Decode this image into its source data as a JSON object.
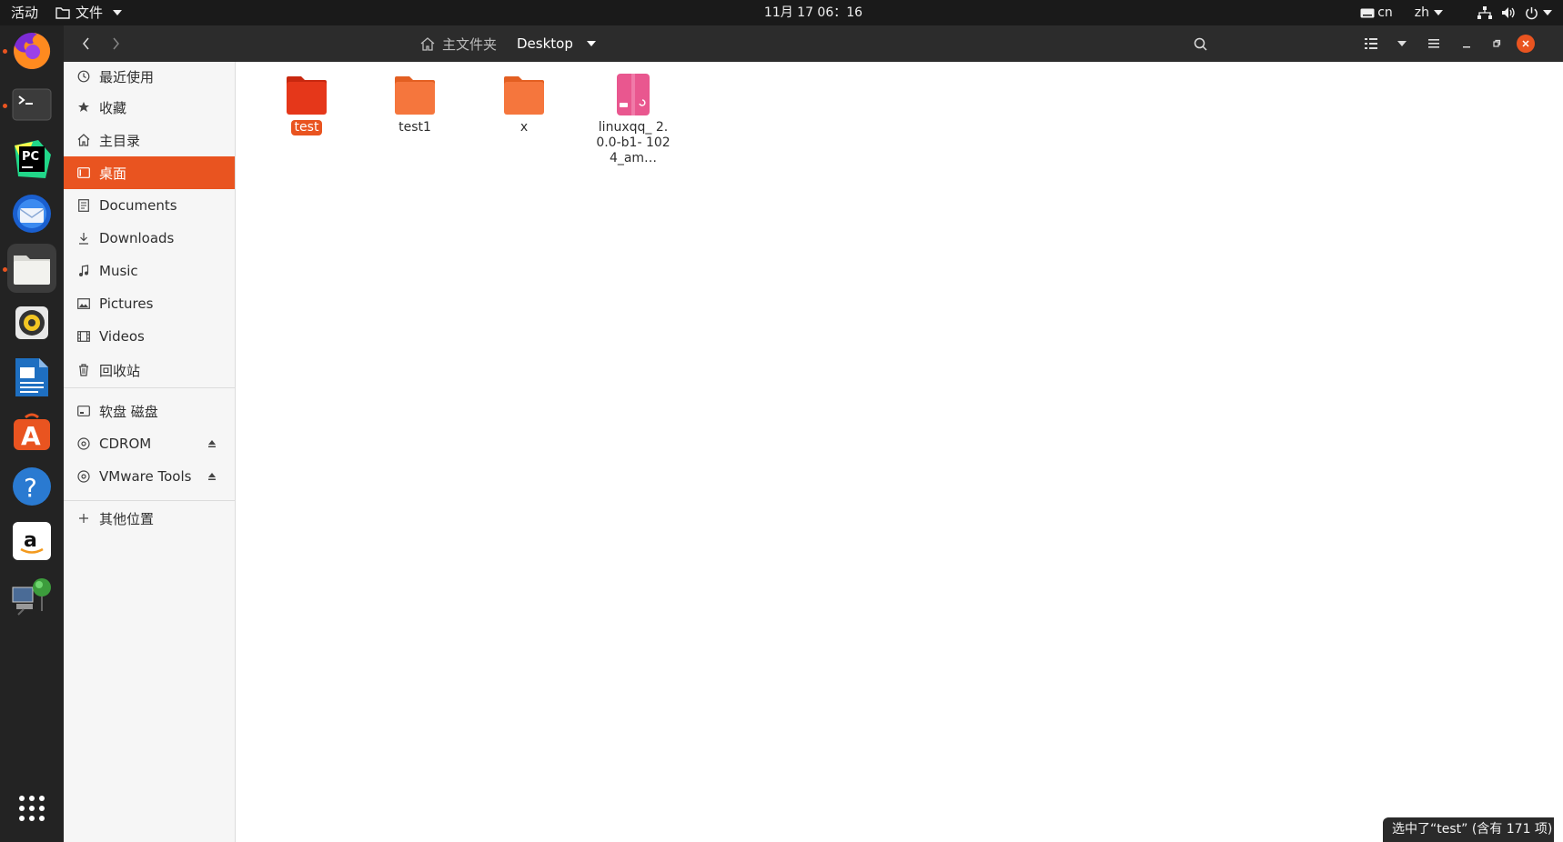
{
  "topbar": {
    "activities": "活动",
    "app_menu": "文件",
    "clock": "11月 17  06：16",
    "keyboard": "cn",
    "input_method": "zh"
  },
  "dock": {
    "items": [
      {
        "name": "firefox",
        "running": true
      },
      {
        "name": "terminal",
        "running": true
      },
      {
        "name": "pycharm",
        "running": false
      },
      {
        "name": "thunderbird",
        "running": false
      },
      {
        "name": "files",
        "running": true,
        "active": true
      },
      {
        "name": "rhythmbox",
        "running": false
      },
      {
        "name": "libreoffice-writer",
        "running": false
      },
      {
        "name": "ubuntu-software",
        "running": false
      },
      {
        "name": "help",
        "running": false
      },
      {
        "name": "amazon",
        "running": false
      },
      {
        "name": "remote-desktop",
        "running": false
      },
      {
        "name": "show-applications",
        "running": false
      }
    ]
  },
  "headerbar": {
    "home_label": "主文件夹",
    "current_label": "Desktop"
  },
  "sidebar": {
    "items": [
      {
        "label": "最近使用",
        "icon": "clock-icon"
      },
      {
        "label": "收藏",
        "icon": "star-icon"
      },
      {
        "label": "主目录",
        "icon": "home-icon"
      },
      {
        "label": "桌面",
        "icon": "desktop-icon",
        "selected": true
      },
      {
        "label": "Documents",
        "icon": "document-icon"
      },
      {
        "label": "Downloads",
        "icon": "download-icon"
      },
      {
        "label": "Music",
        "icon": "music-icon"
      },
      {
        "label": "Pictures",
        "icon": "picture-icon"
      },
      {
        "label": "Videos",
        "icon": "video-icon"
      },
      {
        "label": "回收站",
        "icon": "trash-icon"
      }
    ],
    "devices": [
      {
        "label": "软盘 磁盘",
        "icon": "drive-icon"
      },
      {
        "label": "CDROM",
        "icon": "disc-icon",
        "eject": true
      },
      {
        "label": "VMware Tools",
        "icon": "disc-icon",
        "eject": true
      }
    ],
    "other": {
      "label": "其他位置",
      "icon": "plus-icon"
    }
  },
  "files": [
    {
      "name": "test",
      "type": "folder",
      "selected": true
    },
    {
      "name": "test1",
      "type": "folder"
    },
    {
      "name": "x",
      "type": "folder"
    },
    {
      "name": "linuxqq_ 2.0.0-b1- 1024_am…",
      "type": "deb-package"
    }
  ],
  "status": "选中了“test” (含有 171 项)",
  "colors": {
    "accent": "#e95420",
    "folder": "#f5763d",
    "folder_selected": "#e5371a",
    "package": "#e9578f"
  }
}
